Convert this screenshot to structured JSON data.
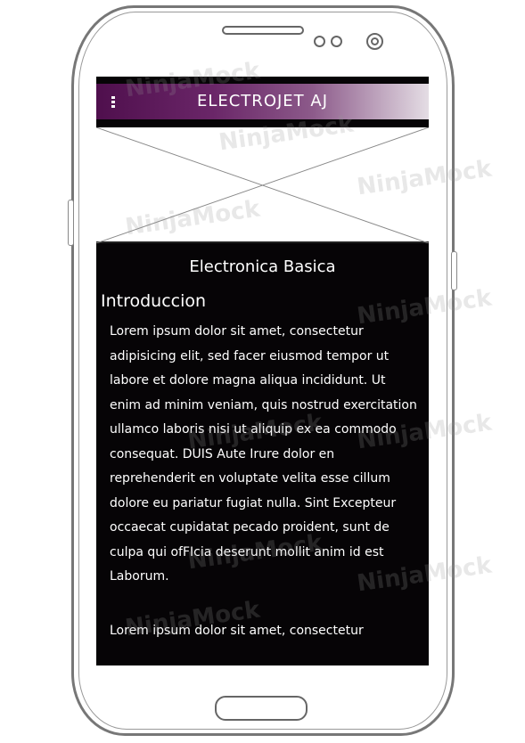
{
  "app": {
    "title": "ELECTROJET AJ",
    "menu_icon": "kebab-menu-icon"
  },
  "hero_image": {
    "icon": "image-placeholder-icon"
  },
  "content": {
    "heading": "Electronica Basica",
    "section_title": "Introduccion",
    "paragraphs": [
      "Lorem ipsum dolor sit amet, consectetur adipisicing elit, sed facer eiusmod tempor ut labore et dolore magna aliqua incididunt. Ut enim ad minim veniam, quis nostrud exercitation ullamco laboris nisi ut aliquip ex ea commodo consequat. DUIS Aute Irure dolor en reprehenderit en voluptate velita esse cillum dolore eu pariatur fugiat nulla. Sint Excepteur occaecat cupidatat pecado proident, sunt de culpa qui ofFIcia deserunt mollit anim id est Laborum.",
      "Lorem ipsum dolor sit amet, consectetur"
    ]
  },
  "watermark": "NinjaMock"
}
